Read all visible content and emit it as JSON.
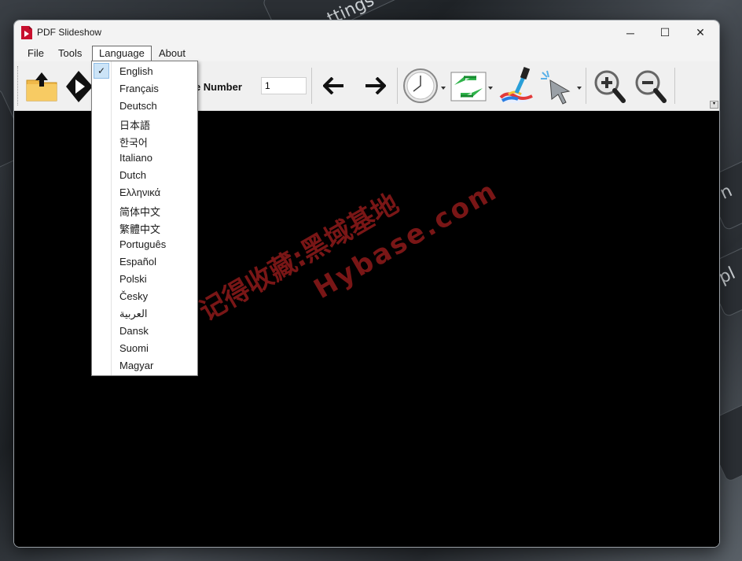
{
  "window": {
    "title": "PDF Slideshow",
    "minimize_glyph": "─",
    "maximize_glyph": "☐",
    "close_glyph": "✕"
  },
  "menubar": {
    "file": "File",
    "tools": "Tools",
    "language": "Language",
    "about": "About"
  },
  "toolbar": {
    "page_label": "ge Number",
    "page_value": "1",
    "icons": [
      "open-folder-icon",
      "play-icon",
      "arrow-left-icon",
      "arrow-right-icon",
      "clock-icon",
      "transition-icon",
      "color-picker-icon",
      "pointer-icon",
      "zoom-in-icon",
      "zoom-out-icon"
    ]
  },
  "language_menu": {
    "selected": "English",
    "items": [
      "English",
      "Français",
      "Deutsch",
      "日本語",
      "한국어",
      "Italiano",
      "Dutch",
      "Ελληνικά",
      "简体中文",
      "繁體中文",
      "Português",
      "Español",
      "Polski",
      "Česky",
      "العربية",
      "Dansk",
      "Suomi",
      "Magyar"
    ]
  },
  "watermark": {
    "line1": "记得收藏:黑域基地",
    "line2": "Hybase.com"
  },
  "desktop": {
    "key_label_top": "ttings",
    "key_label_right1": "n",
    "key_label_right2": "pl"
  },
  "colors": {
    "titlebar": "#f3f3f3",
    "content_bg": "#000000",
    "selection": "#cce4f7",
    "app_icon": "#c8102e"
  }
}
